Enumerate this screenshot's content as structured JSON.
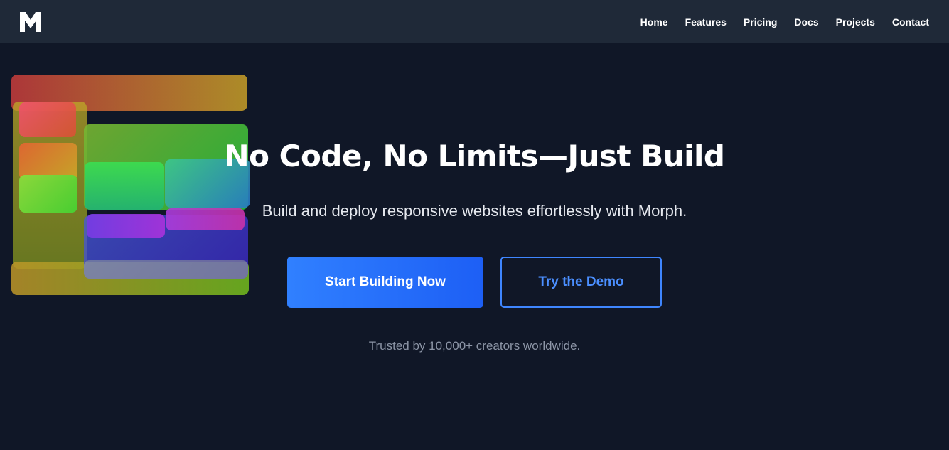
{
  "brand": {
    "logo_letter": "M",
    "logo_color": "#ffffff"
  },
  "nav": {
    "items": [
      "Home",
      "Features",
      "Pricing",
      "Docs",
      "Projects",
      "Contact"
    ]
  },
  "hero": {
    "title": "No Code, No Limits—Just Build",
    "subtitle": "Build and deploy responsive websites effortlessly with Morph.",
    "primary_cta": "Start Building Now",
    "secondary_cta": "Try the Demo",
    "trust_text": "Trusted by 10,000+ creators worldwide."
  },
  "colors": {
    "background": "#101727",
    "navbar": "#1f2938",
    "accent": "#3080ff",
    "text": "#ffffff",
    "muted": "#8c95a6"
  }
}
